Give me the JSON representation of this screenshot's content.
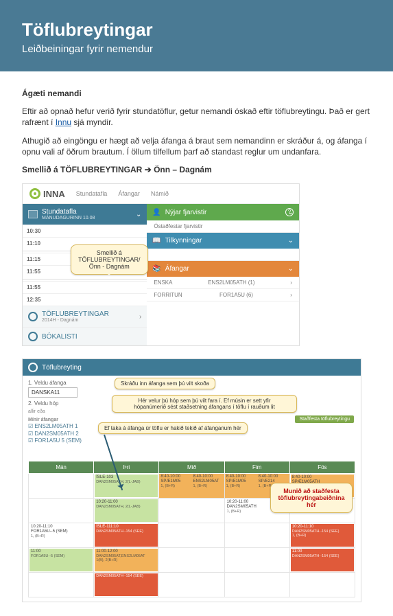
{
  "banner": {
    "title": "Töflubreytingar",
    "subtitle": "Leiðbeiningar fyrir nemendur"
  },
  "intro": {
    "greeting": "Ágæti nemandi",
    "p1a": "Eftir að opnað hefur verið fyrir stundatöflur, getur nemandi óskað eftir töflubreytingu. Það er gert rafrænt í ",
    "link": "Innu",
    "p1b": " sjá myndir.",
    "p2": "Athugið að eingöngu er hægt að velja áfanga á braut sem nemandinn er skráður á, og áfanga í opnu vali af öðrum brautum. Í öllum tilfellum þarf að standast reglur um undanfara.",
    "p3a": "Smellið á TÖFLUBREYTINGAR ",
    "p3b": " Önn – Dagnám"
  },
  "s1": {
    "brand": "INNA",
    "tabs": [
      "Stundatafla",
      "Áfangar",
      "Námið"
    ],
    "left_title": "Stundatafla",
    "left_sub": "MÁNUDAGURINN 10.08",
    "rows": [
      {
        "from": "10:30",
        "to": "11:10"
      },
      {
        "from": "11:15",
        "to": "11:55"
      },
      {
        "from": "11:55",
        "to": "12:35"
      }
    ],
    "section1": "TÖFLUBREYTINGAR",
    "section1_sub": "2014H - Dagnám",
    "section2": "BÓKALISTI",
    "cards": {
      "green": "Nýjar fjarvistir",
      "green_sub": "Óstaðfestar fjarvistir",
      "blue": "Tilkynningar",
      "orange": "Áfangar",
      "af1_name": "ENSKA",
      "af1_code": "ENS2LM05ATH (1)",
      "af2_name": "FORRITUN",
      "af2_code": "FOR1A5U (6)"
    },
    "callout_l1": "Smellið á",
    "callout_l2": "TÖFLUBREYTINGAR/",
    "callout_l3": "Önn - Dagnám"
  },
  "s2": {
    "head": "Töflubreyting",
    "sel_label": "1. Veldu áfanga",
    "sel_value": "DANSKA11",
    "grp_label": "2. Veldu hóp",
    "grp_a": "allir",
    "grp_b": "eða",
    "list_head": "Mínir áfangar",
    "list": [
      "ENS2LM05ATH 1",
      "DAN2SM05ATH 2",
      "FOR1A5U 5 (SEM)"
    ],
    "confirm_btn": "Staðfesta töflubreytingu",
    "co1": "Skráðu inn áfanga sem þú vilt skoða",
    "co2a": "Hér velur þú hóp sem þú vilt fara í. Ef músin er sett yfir",
    "co2b": "hópanúmerið sést staðsetning áfangans í töflu í rauðum lit",
    "co3": "Ef taka á áfanga úr töflu er hakið tekið af áfanganum hér",
    "co4a": "Munið að staðfesta",
    "co4b": "töflubreytingabeiðnina hér",
    "days": [
      "Mán",
      "Þri",
      "Mið",
      "Fim",
      "Fös"
    ],
    "cells": {
      "r1c2_top": "ÍSLE-103",
      "r1c2_bot": "DAN2SM05ATH, 2(L-JAB)",
      "r1c3a_top": "8:40-10:00",
      "r1c3a_mid": "SPÆ1M05",
      "r1c3a_bot": "1, (B+R)",
      "r1c3b_top": "8:40-10:00",
      "r1c3b_mid": "ENS2LM05AT",
      "r1c3b_bot": "1, (B+R)",
      "r1c4a_top": "8:40-10:00",
      "r1c4a_mid": "SPÆ1M05",
      "r1c4a_bot": "1, (B+R)",
      "r1c4b_top": "8:40-10:00",
      "r1c4b_mid": "SPÆ214",
      "r1c4b_bot": "1, (B+R)",
      "r1c5_top": "8:40-10:00",
      "r1c5_mid": "SPÆ1M05ATH",
      "r1c5_bot": "1, (B+R)",
      "r2c2_top": "10:20-11:00",
      "r2c2_bot": "DAN2SM05ATH, 2(L-JAB)",
      "r2c4_top": "10:20-11:00",
      "r2c4_mid": "DAN2SM05ATH",
      "r2c4_bot": "1, (B+R)",
      "r3c1a": "10:20-11:10",
      "r3c1b": "FOR1A5U--5 (SEM)",
      "r3c1c": "1, (B+R)",
      "r3c2a": "ÍSLE-111:10",
      "r3c2b": "DAN2SM05ATH--154 (SEE)",
      "r3c5a": "10:20-11:10",
      "r3c5b": "DAN2SM05ATH--154 (SEE)",
      "r3c5c": "1, (B+R)",
      "r4c1a": "11:00",
      "r4c1b": "FOR1A5U--5 (SEM)",
      "r4c2a": "11:00-12:00",
      "r4c2b": "DAN2SM05AT,ENS2LM05AT",
      "r4c2c": "1(B), 2(B+R)",
      "r4c5a": "11:00",
      "r4c5b": "DAN2SM05ATH--154 (SEE)",
      "r5c2": "DAN2SM05ATH--154 (SEE)"
    }
  }
}
